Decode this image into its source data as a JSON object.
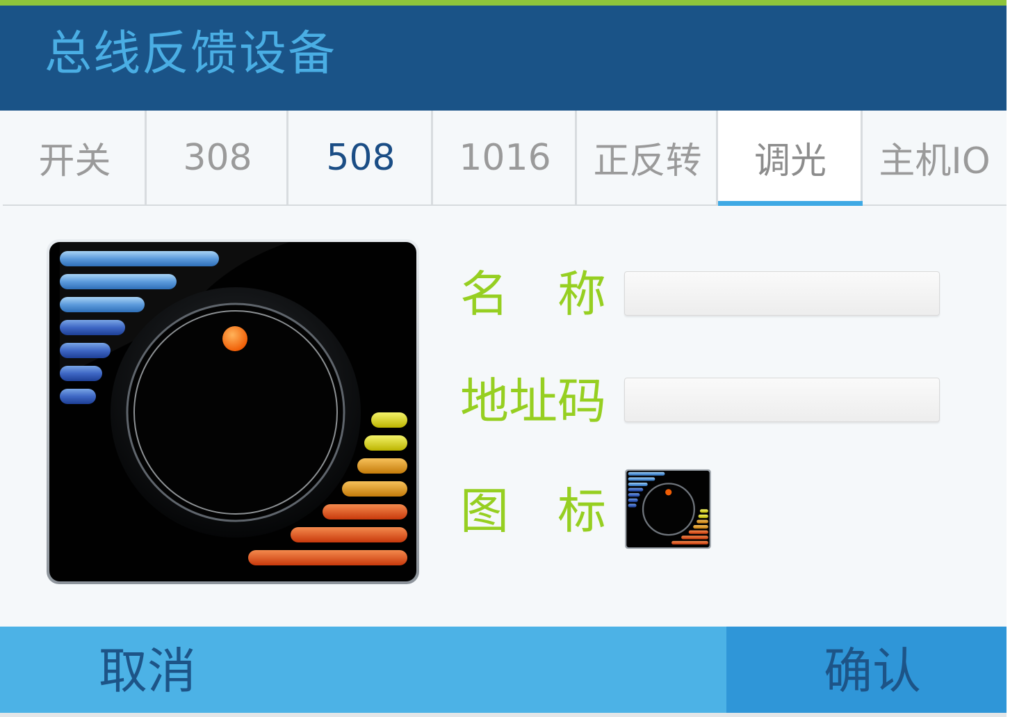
{
  "header": {
    "title": "总线反馈设备"
  },
  "tabs": [
    {
      "label": "开关"
    },
    {
      "label": "308"
    },
    {
      "label": "508"
    },
    {
      "label": "1016"
    },
    {
      "label": "正反转"
    },
    {
      "label": "调光"
    },
    {
      "label": "主机IO"
    }
  ],
  "selected_tab": "调光",
  "form": {
    "name_label": "名　称",
    "name_value": "",
    "address_label": "地址码",
    "address_value": "",
    "icon_label": "图　标",
    "icon_name": "dimmer-knob-icon"
  },
  "footer": {
    "cancel_label": "取消",
    "confirm_label": "确认"
  },
  "colors": {
    "header_bg": "#1a5387",
    "title": "#4aaee4",
    "accent_green": "#96cf21",
    "tab_underline": "#3ea9e4",
    "cancel_bg": "#4cb2e6",
    "confirm_bg": "#2f96d8"
  }
}
